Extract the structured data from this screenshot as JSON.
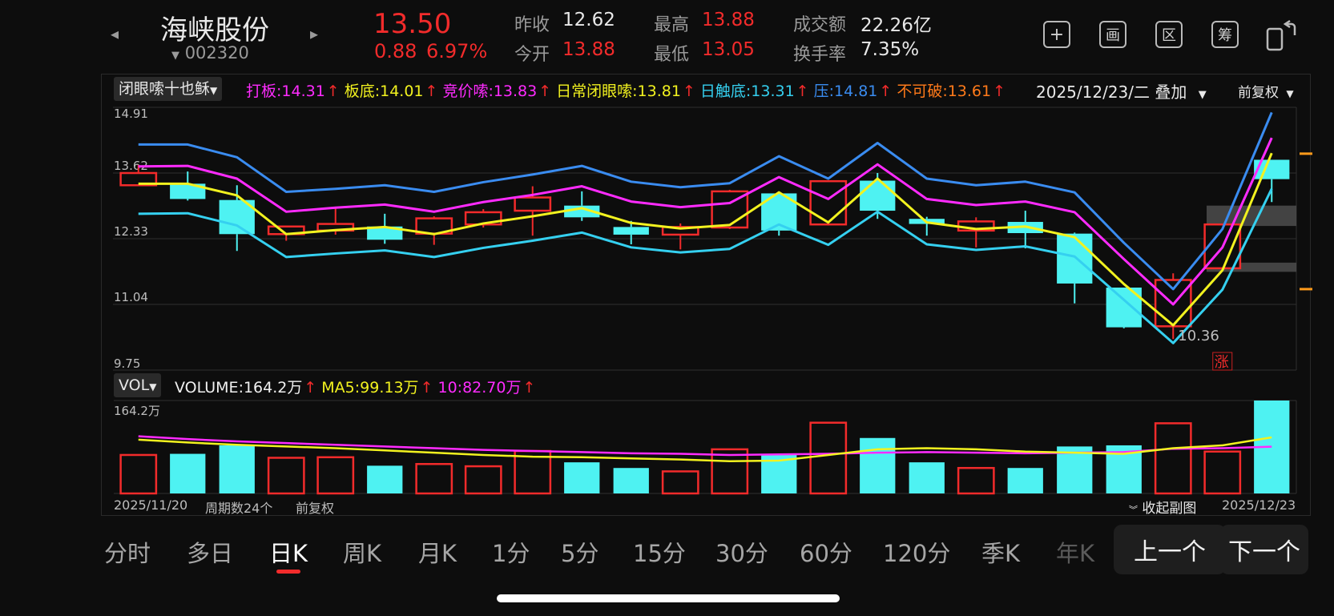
{
  "stock": {
    "name": "海峡股份",
    "code": "002320",
    "price": "13.50",
    "change": "0.88",
    "change_pct": "6.97%"
  },
  "quote": {
    "prev_close_label": "昨收",
    "prev_close": "12.62",
    "open_label": "今开",
    "open": "13.88",
    "high_label": "最高",
    "high": "13.88",
    "low_label": "最低",
    "low": "13.05",
    "turnover_amt_label": "成交额",
    "turnover_amt": "22.26亿",
    "turnover_rate_label": "换手率",
    "turnover_rate": "7.35%"
  },
  "header_icons": [
    "plus-square-icon",
    "chart-square-icon",
    "zone-square-icon",
    "chip-square-icon",
    "switch-device-icon"
  ],
  "header_icon_glyphs": [
    "+",
    "画",
    "区",
    "筹",
    ""
  ],
  "indicator": {
    "name": "闭眼嗦十也稣",
    "items": [
      {
        "text": "打板:14.31",
        "color": "#ff2bff"
      },
      {
        "text": "板底:14.01",
        "color": "#f2f21f"
      },
      {
        "text": "竞价嗦:13.83",
        "color": "#ff2bff"
      },
      {
        "text": "日常闭眼嗦:13.81",
        "color": "#f2f21f"
      },
      {
        "text": "日触底:13.31",
        "color": "#35d0f0"
      },
      {
        "text": "压:14.81",
        "color": "#3a8cf0"
      },
      {
        "text": "不可破:13.61",
        "color": "#ff7a1a"
      }
    ],
    "arrow": "↑",
    "date_overlay": "2025/12/23/二 叠加",
    "adjust": "前复权"
  },
  "volume": {
    "name": "VOL",
    "items": [
      {
        "text": "VOLUME:164.2万",
        "color": "#f0f0f0"
      },
      {
        "text": "MA5:99.13万",
        "color": "#f2f21f"
      },
      {
        "text": "10:82.70万",
        "color": "#ff2bff"
      }
    ],
    "max_label": "164.2万"
  },
  "footer": {
    "start_date": "2025/11/20",
    "periods": "周期数24个",
    "adjust": "前复权",
    "collapse": "收起副图",
    "end_date": "2025/12/23"
  },
  "tabs": [
    "分时",
    "多日",
    "日K",
    "周K",
    "月K",
    "1分",
    "5分",
    "15分",
    "30分",
    "60分",
    "120分",
    "季K",
    "年K"
  ],
  "active_tab": "日K",
  "nav": {
    "prev": "上一个",
    "next": "下一个"
  },
  "colors": {
    "up": "#f22b2b",
    "down": "#4ef2f2",
    "blue": "#3a8cf0",
    "magenta": "#ff2bff",
    "yellow": "#f2f21f",
    "cyan": "#35d0f0",
    "orange": "#ff9a1a"
  },
  "chart_data": {
    "type": "candlestick",
    "y_ticks": [
      "14.91",
      "13.62",
      "12.33",
      "11.04",
      "9.75"
    ],
    "ylim": [
      9.75,
      14.91
    ],
    "low_marker": "10.36",
    "limit_up_marker": "涨",
    "candles": [
      {
        "o": 13.38,
        "c": 13.62,
        "h": 13.78,
        "l": 13.38
      },
      {
        "o": 13.41,
        "c": 13.11,
        "h": 13.65,
        "l": 13.08
      },
      {
        "o": 13.09,
        "c": 12.42,
        "h": 13.38,
        "l": 12.09
      },
      {
        "o": 12.42,
        "c": 12.57,
        "h": 12.58,
        "l": 12.29
      },
      {
        "o": 12.49,
        "c": 12.62,
        "h": 12.95,
        "l": 12.41
      },
      {
        "o": 12.57,
        "c": 12.31,
        "h": 12.82,
        "l": 12.23
      },
      {
        "o": 12.43,
        "c": 12.73,
        "h": 12.77,
        "l": 12.21
      },
      {
        "o": 12.61,
        "c": 12.85,
        "h": 12.91,
        "l": 12.55
      },
      {
        "o": 12.88,
        "c": 13.14,
        "h": 13.36,
        "l": 12.39
      },
      {
        "o": 12.98,
        "c": 12.75,
        "h": 13.26,
        "l": 12.68
      },
      {
        "o": 12.56,
        "c": 12.41,
        "h": 12.68,
        "l": 12.22
      },
      {
        "o": 12.41,
        "c": 12.56,
        "h": 12.63,
        "l": 12.12
      },
      {
        "o": 12.55,
        "c": 13.26,
        "h": 13.29,
        "l": 12.52
      },
      {
        "o": 13.22,
        "c": 12.49,
        "h": 13.26,
        "l": 12.39
      },
      {
        "o": 12.61,
        "c": 13.46,
        "h": 13.46,
        "l": 12.59
      },
      {
        "o": 13.47,
        "c": 12.88,
        "h": 13.62,
        "l": 12.72
      },
      {
        "o": 12.72,
        "c": 12.62,
        "h": 12.76,
        "l": 12.39
      },
      {
        "o": 12.49,
        "c": 12.67,
        "h": 12.75,
        "l": 12.16
      },
      {
        "o": 12.66,
        "c": 12.44,
        "h": 12.88,
        "l": 12.14
      },
      {
        "o": 12.43,
        "c": 11.45,
        "h": 12.45,
        "l": 11.06
      },
      {
        "o": 11.37,
        "c": 10.59,
        "h": 11.37,
        "l": 10.57
      },
      {
        "o": 10.61,
        "c": 11.52,
        "h": 11.65,
        "l": 10.36
      },
      {
        "o": 11.75,
        "c": 12.61,
        "h": 12.61,
        "l": 11.75
      },
      {
        "o": 13.88,
        "c": 13.5,
        "h": 13.88,
        "l": 13.05
      }
    ],
    "overlay_lines": [
      {
        "name": "压",
        "color": "#3a8cf0",
        "values": [
          14.18,
          14.18,
          13.93,
          13.25,
          13.31,
          13.38,
          13.25,
          13.44,
          13.59,
          13.76,
          13.45,
          13.34,
          13.42,
          13.95,
          13.51,
          14.21,
          13.51,
          13.38,
          13.45,
          13.24,
          12.25,
          11.34,
          12.52,
          14.81
        ]
      },
      {
        "name": "打板",
        "color": "#ff2bff",
        "values": [
          13.75,
          13.76,
          13.51,
          12.86,
          12.94,
          13.0,
          12.86,
          13.05,
          13.19,
          13.36,
          13.06,
          12.95,
          13.03,
          13.54,
          13.11,
          13.79,
          13.11,
          12.99,
          13.06,
          12.85,
          11.93,
          11.04,
          12.16,
          14.31
        ]
      },
      {
        "name": "板底",
        "color": "#f2f21f",
        "values": [
          13.41,
          13.41,
          13.18,
          12.42,
          12.5,
          12.56,
          12.42,
          12.63,
          12.77,
          12.93,
          12.64,
          12.53,
          12.6,
          13.24,
          12.65,
          13.51,
          12.65,
          12.52,
          12.57,
          12.36,
          11.44,
          10.63,
          11.71,
          14.01
        ]
      },
      {
        "name": "日触底",
        "color": "#35d0f0",
        "values": [
          12.82,
          12.83,
          12.59,
          11.97,
          12.04,
          12.1,
          11.97,
          12.15,
          12.29,
          12.45,
          12.16,
          12.06,
          12.13,
          12.61,
          12.21,
          12.86,
          12.22,
          12.11,
          12.18,
          11.98,
          11.13,
          10.28,
          11.33,
          13.31
        ]
      }
    ],
    "right_markers": [
      {
        "type": "tick",
        "y": 14.0,
        "color": "#ff9a1a"
      },
      {
        "type": "band",
        "y1": 12.98,
        "y2": 12.58,
        "color": "#555555"
      },
      {
        "type": "band",
        "y1": 11.86,
        "y2": 11.68,
        "color": "#555555"
      },
      {
        "type": "tick",
        "y": 11.34,
        "color": "#ff9a1a"
      }
    ],
    "volume_values": [
      68,
      70,
      85,
      63,
      64,
      49,
      52,
      48,
      75,
      55,
      45,
      39,
      78,
      70,
      125,
      98,
      55,
      45,
      45,
      83,
      85,
      124,
      74,
      164.2
    ],
    "volume_ma5": [
      95,
      90,
      86,
      83,
      80,
      76,
      72,
      68,
      65,
      64,
      62,
      60,
      57,
      58,
      68,
      78,
      80,
      78,
      74,
      72,
      70,
      80,
      85,
      99.13
    ],
    "volume_ma10": [
      101,
      96,
      92,
      89,
      86,
      83,
      80,
      77,
      75,
      73,
      71,
      70,
      68,
      69,
      70,
      72,
      73,
      72,
      71,
      72,
      73,
      79,
      80,
      82.7
    ],
    "volume_ylim": [
      0,
      164.2
    ]
  }
}
